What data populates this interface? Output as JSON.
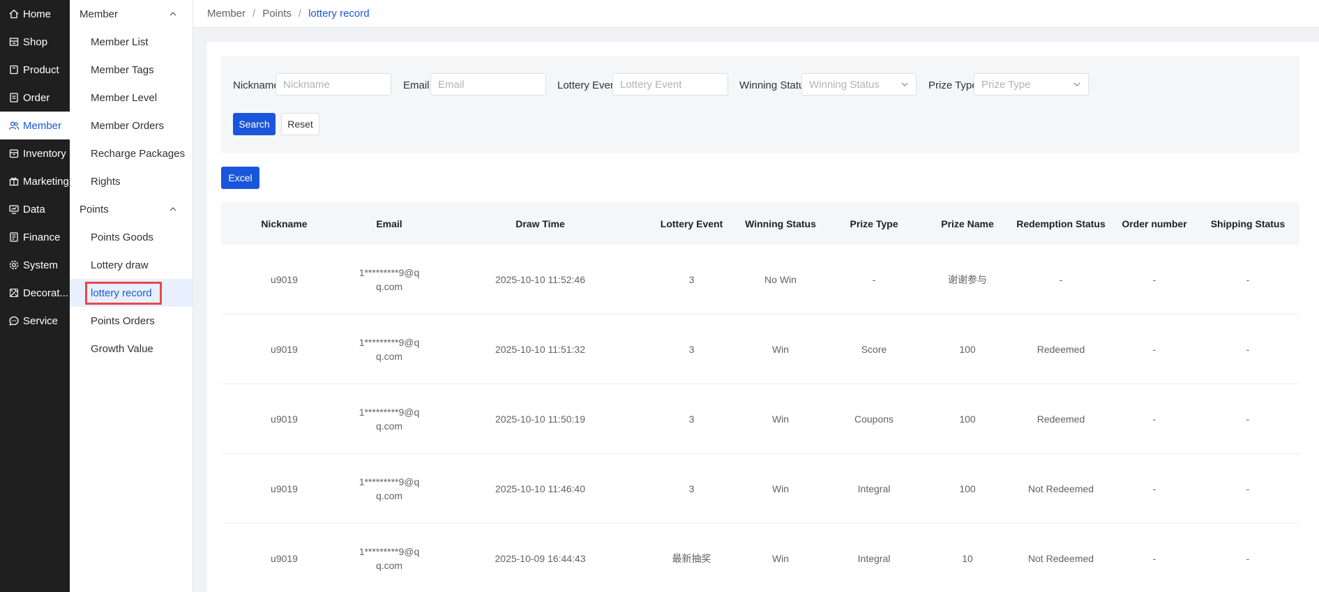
{
  "rail": {
    "items": [
      {
        "label": "Home",
        "icon": "home-icon"
      },
      {
        "label": "Shop",
        "icon": "shop-icon"
      },
      {
        "label": "Product",
        "icon": "product-icon"
      },
      {
        "label": "Order",
        "icon": "order-icon"
      },
      {
        "label": "Member",
        "icon": "member-icon",
        "active": true
      },
      {
        "label": "Inventory",
        "icon": "inventory-icon"
      },
      {
        "label": "Marketing",
        "icon": "marketing-icon"
      },
      {
        "label": "Data",
        "icon": "data-icon"
      },
      {
        "label": "Finance",
        "icon": "finance-icon"
      },
      {
        "label": "System",
        "icon": "system-icon"
      },
      {
        "label": "Decorat...",
        "icon": "decoration-icon"
      },
      {
        "label": "Service",
        "icon": "service-icon"
      }
    ]
  },
  "submenu": {
    "member_group": "Member",
    "member_items": [
      "Member List",
      "Member Tags",
      "Member Level",
      "Member Orders",
      "Recharge Packages",
      "Rights"
    ],
    "points_group": "Points",
    "points_items": [
      "Points Goods",
      "Lottery draw",
      "lottery record",
      "Points Orders",
      "Growth Value"
    ],
    "active_item": "lottery record"
  },
  "breadcrumb": {
    "items": [
      "Member",
      "Points"
    ],
    "current": "lottery record",
    "separator": "/"
  },
  "filter": {
    "nickname_label": "Nickname",
    "nickname_placeholder": "Nickname",
    "email_label": "Email",
    "email_placeholder": "Email",
    "event_label": "Lottery Event",
    "event_placeholder": "Lottery Event",
    "status_label": "Winning Status",
    "status_placeholder": "Winning Status",
    "prize_label": "Prize Type",
    "prize_placeholder": "Prize Type",
    "search_label": "Search",
    "reset_label": "Reset"
  },
  "toolbar": {
    "excel_label": "Excel"
  },
  "table": {
    "headers": [
      "Nickname",
      "Email",
      "Draw Time",
      "Lottery Event",
      "Winning Status",
      "Prize Type",
      "Prize Name",
      "Redemption Status",
      "Order number",
      "Shipping Status"
    ],
    "rows": [
      [
        "u9019",
        "1*********9@qq.com",
        "2025-10-10 11:52:46",
        "3",
        "No Win",
        "-",
        "谢谢参与",
        "-",
        "-",
        "-"
      ],
      [
        "u9019",
        "1*********9@qq.com",
        "2025-10-10 11:51:32",
        "3",
        "Win",
        "Score",
        "100",
        "Redeemed",
        "-",
        "-"
      ],
      [
        "u9019",
        "1*********9@qq.com",
        "2025-10-10 11:50:19",
        "3",
        "Win",
        "Coupons",
        "100",
        "Redeemed",
        "-",
        "-"
      ],
      [
        "u9019",
        "1*********9@qq.com",
        "2025-10-10 11:46:40",
        "3",
        "Win",
        "Integral",
        "100",
        "Not Redeemed",
        "-",
        "-"
      ],
      [
        "u9019",
        "1*********9@qq.com",
        "2025-10-09 16:44:43",
        "最新抽奖",
        "Win",
        "Integral",
        "10",
        "Not Redeemed",
        "-",
        "-"
      ]
    ]
  },
  "colors": {
    "accent": "#1a56db",
    "rail_bg": "#1f1f1f",
    "highlight_box": "#e5484d"
  }
}
